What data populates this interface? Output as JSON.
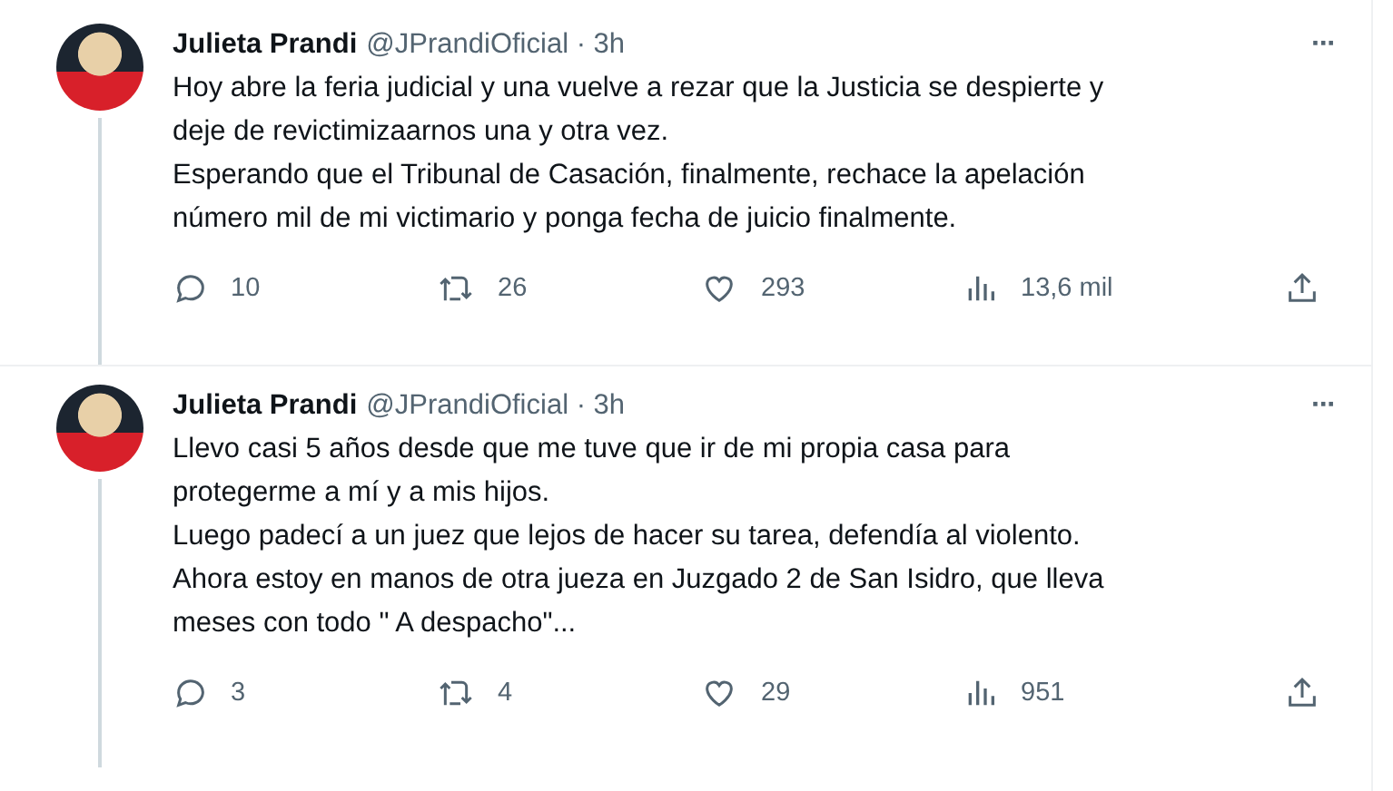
{
  "tweets": [
    {
      "name": "Julieta Prandi",
      "handle": "@JPrandiOficial",
      "separator": "·",
      "time": "3h",
      "more": "···",
      "text": "Hoy abre la feria judicial y una vuelve a rezar que la Justicia se despierte y\ndeje de revictimizaarnos una y otra vez.\nEsperando que el Tribunal de Casación, finalmente, rechace la apelación\nnúmero mil de mi victimario y ponga fecha de juicio finalmente.",
      "replies": "10",
      "retweets": "26",
      "likes": "293",
      "views": "13,6 mil"
    },
    {
      "name": "Julieta Prandi",
      "handle": "@JPrandiOficial",
      "separator": "·",
      "time": "3h",
      "more": "···",
      "text": "Llevo casi 5 años desde que me tuve que ir de mi propia casa para\nprotegerme a mí y a mis hijos.\nLuego padecí a un juez que lejos de hacer su tarea, defendía al violento.\nAhora estoy en manos de otra jueza en Juzgado 2 de San Isidro, que lleva\nmeses con todo \" A despacho\"...",
      "replies": "3",
      "retweets": "4",
      "likes": "29",
      "views": "951"
    }
  ]
}
